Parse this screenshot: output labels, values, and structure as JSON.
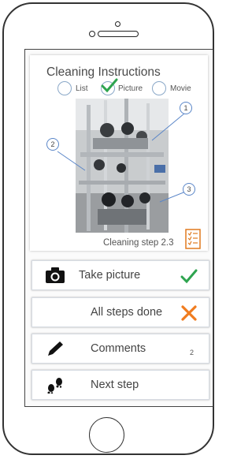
{
  "instructions": {
    "title": "Cleaning Instructions",
    "view_options": [
      {
        "label": "List",
        "selected": false
      },
      {
        "label": "Picture",
        "selected": true
      },
      {
        "label": "Movie",
        "selected": false
      }
    ],
    "callouts": [
      "1",
      "2",
      "3"
    ],
    "step_label": "Cleaning step 2.3"
  },
  "actions": [
    {
      "label": "Take picture",
      "icon": "camera-icon",
      "status": "check-icon"
    },
    {
      "label": "All steps done",
      "icon": "",
      "status": "cross-icon"
    },
    {
      "label": "Comments",
      "icon": "pen-icon",
      "count": "2"
    },
    {
      "label": "Next step",
      "icon": "footsteps-icon"
    }
  ],
  "colors": {
    "accent_blue": "#5a86c8",
    "check_green": "#2ea44f",
    "cross_orange": "#f07c1f",
    "checklist_orange": "#e07a1f"
  }
}
